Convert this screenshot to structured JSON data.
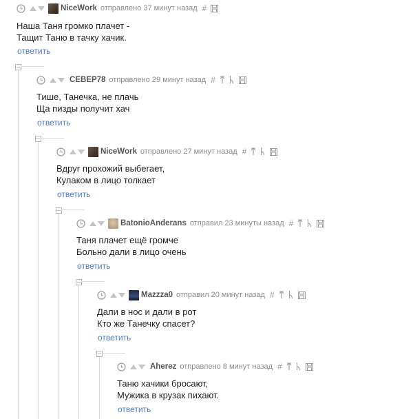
{
  "comments": [
    {
      "author": "NiceWork",
      "meta": "отправлено 37 минут назад",
      "tools": "# ⎙",
      "lines": [
        "Наша Таня громко плачет -",
        "Тащит Таню в тачку хачик."
      ],
      "reply": "ответить"
    },
    {
      "author": "CEBEP78",
      "meta": "отправлено 29 минут назад",
      "tools": "# ↑ ↳ ⎙",
      "lines": [
        "Тише, Танечка, не плачь",
        "Ща пизды получит хач"
      ],
      "reply": "ответить"
    },
    {
      "author": "NiceWork",
      "meta": "отправлено 27 минут назад",
      "tools": "# ↑ ↳ ⎙",
      "lines": [
        "Вдруг прохожий выбегает,",
        "Кулаком в лицо толкает"
      ],
      "reply": "ответить"
    },
    {
      "author": "BatonioAnderans",
      "meta": "отправил 23 минуты назад",
      "tools": "# ↑ ↳ ⎙",
      "lines": [
        "Таня плачет ещё громче",
        "Больно дали в лицо очень"
      ],
      "reply": "ответить"
    },
    {
      "author": "Mazzza0",
      "meta": "отправил 20 минут назад",
      "tools": "# ↑ ↳ ⎙",
      "lines": [
        "Дали в нос и дали в рот",
        "Кто же Танечку спасет?"
      ],
      "reply": "ответить"
    },
    {
      "author": "Aherez",
      "meta": "отправлено 8 минут назад",
      "tools": "# ↑ ↳ ⎙",
      "lines": [
        "Таню хачики бросают,",
        "Мужика в крузак пихают."
      ],
      "reply": "ответить"
    }
  ],
  "colors": {
    "link": "#4a7bd1",
    "author": "#555555",
    "meta": "#8a8a8a",
    "thread": "#d8d8d8"
  },
  "icons": [
    "clock-icon",
    "vote-up-icon",
    "vote-down-icon",
    "hash-icon",
    "parent-icon",
    "thread-icon",
    "save-icon"
  ]
}
